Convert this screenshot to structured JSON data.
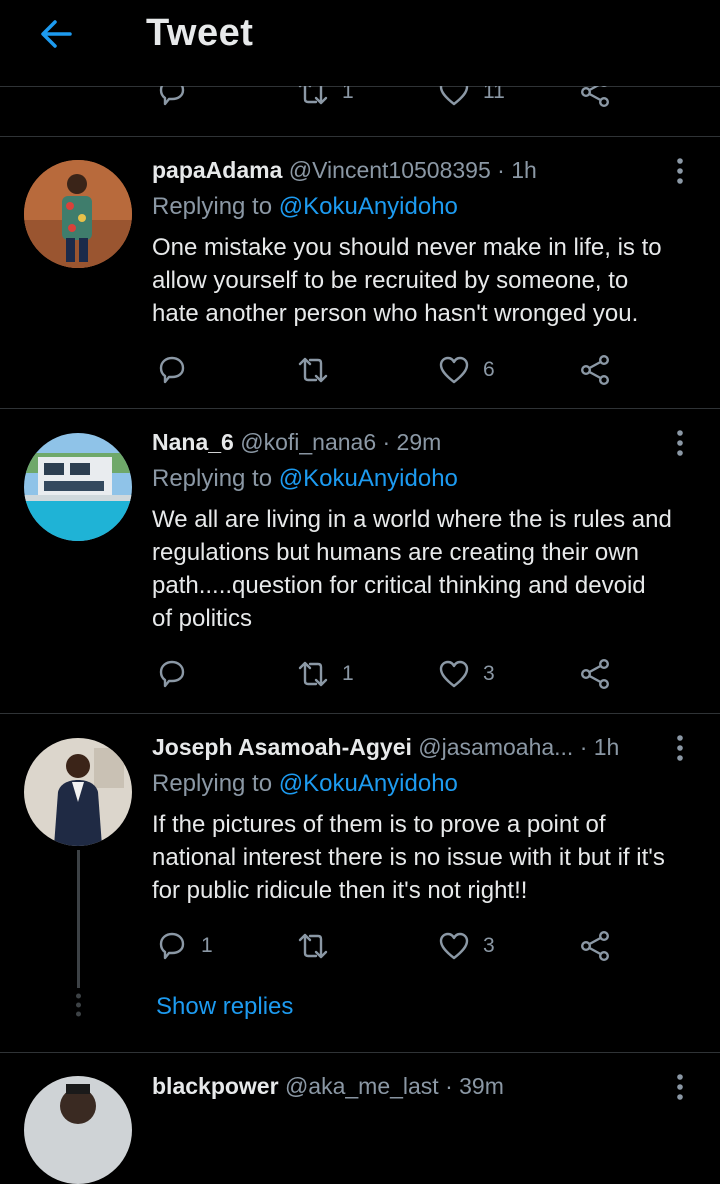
{
  "header": {
    "title": "Tweet"
  },
  "top_actions": {
    "retweets": "1",
    "likes": "11"
  },
  "tweets": [
    {
      "name": "papaAdama",
      "handle": "@Vincent10508395",
      "time": "· 1h",
      "replying_prefix": "Replying to",
      "mention": "@KokuAnyidoho",
      "lines": [
        "One mistake you should never make in life, is to",
        "allow yourself to be recruited by someone, to",
        "hate another person who hasn't wronged you."
      ],
      "replies": "",
      "retweets": "",
      "likes": "6"
    },
    {
      "name": "Nana_6",
      "handle": "@kofi_nana6",
      "time": "· 29m",
      "replying_prefix": "Replying to",
      "mention": "@KokuAnyidoho",
      "lines": [
        "We all are living in a world where the is rules and",
        "regulations but humans are creating their own",
        "path.....question for critical thinking and devoid",
        "of politics"
      ],
      "replies": "",
      "retweets": "1",
      "likes": "3"
    },
    {
      "name": "Joseph Asamoah-Agyei",
      "handle": "@jasamoaha...",
      "time": "· 1h",
      "replying_prefix": "Replying to",
      "mention": "@KokuAnyidoho",
      "lines": [
        "If the pictures of them is to prove a point of",
        "national interest there is no issue with it but if  it's",
        "for public ridicule then it's not right!!"
      ],
      "replies": "1",
      "retweets": "",
      "likes": "3",
      "show_replies": "Show replies"
    },
    {
      "name": "blackpower",
      "handle": "@aka_me_last",
      "time": "· 39m"
    }
  ],
  "colors": {
    "accent": "#1d9bf0",
    "muted": "#8b98a5",
    "text": "#e7e9ea",
    "bg": "#000000"
  },
  "icons": [
    "back-arrow-icon",
    "reply-icon",
    "retweet-icon",
    "like-icon",
    "share-icon",
    "more-icon"
  ]
}
